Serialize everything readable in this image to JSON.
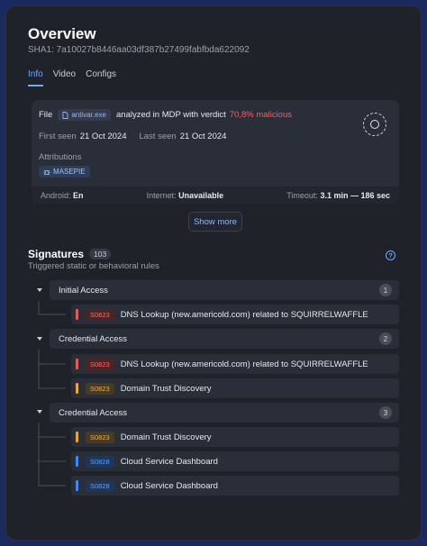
{
  "header": {
    "title": "Overview",
    "sha": "SHA1: 7a10027b8446aa03df387b27499fabfbda622092"
  },
  "tabs": [
    {
      "label": "Info",
      "active": true
    },
    {
      "label": "Video",
      "active": false
    },
    {
      "label": "Configs",
      "active": false
    }
  ],
  "summary": {
    "file_label": "File",
    "file_name": "antivar.exe",
    "analyzed_text": "analyzed in MDP with verdict",
    "verdict": "70,8% malicious",
    "first_seen_label": "First seen",
    "first_seen": "21 Oct 2024",
    "last_seen_label": "Last seen",
    "last_seen": "21 Oct 2024",
    "attributions_label": "Attributions",
    "attribution": "MASEPIE",
    "footer": {
      "android_label": "Android:",
      "android": "En",
      "internet_label": "Internet:",
      "internet": "Unavailable",
      "timeout_label": "Timeout:",
      "timeout": "3.1 min — 186 sec"
    }
  },
  "show_more_label": "Show more",
  "signatures": {
    "title": "Signatures",
    "count": "103",
    "subtitle": "Triggered static or behavioral rules",
    "help_glyph": "?",
    "groups": [
      {
        "label": "Initial Access",
        "num": "1",
        "items": [
          {
            "code": "S0823",
            "color": "red",
            "text": "DNS Lookup (new.americold.com) related to SQUIRRELWAFFLE"
          }
        ]
      },
      {
        "label": "Credential Access",
        "num": "2",
        "items": [
          {
            "code": "S0823",
            "color": "red",
            "text": "DNS Lookup (new.americold.com) related to SQUIRRELWAFFLE"
          },
          {
            "code": "S0823",
            "color": "amber",
            "text": "Domain Trust Discovery"
          }
        ]
      },
      {
        "label": "Credential Access",
        "num": "3",
        "items": [
          {
            "code": "S0823",
            "color": "amber",
            "text": "Domain Trust Discovery"
          },
          {
            "code": "S0828",
            "color": "blue",
            "text": "Cloud Service Dashboard"
          },
          {
            "code": "S0828",
            "color": "blue",
            "text": "Cloud Service Dashboard"
          }
        ]
      }
    ]
  },
  "colors": {
    "accent": "#6fa8ff",
    "malicious": "#ff5c5c",
    "red": "#e25b5b",
    "amber": "#e7a73a",
    "blue": "#3d8bf0"
  },
  "icons": {
    "file": "file-icon",
    "attribution": "bug-icon",
    "target": "target-icon",
    "caret": "caret-down-icon",
    "help": "help-icon"
  }
}
